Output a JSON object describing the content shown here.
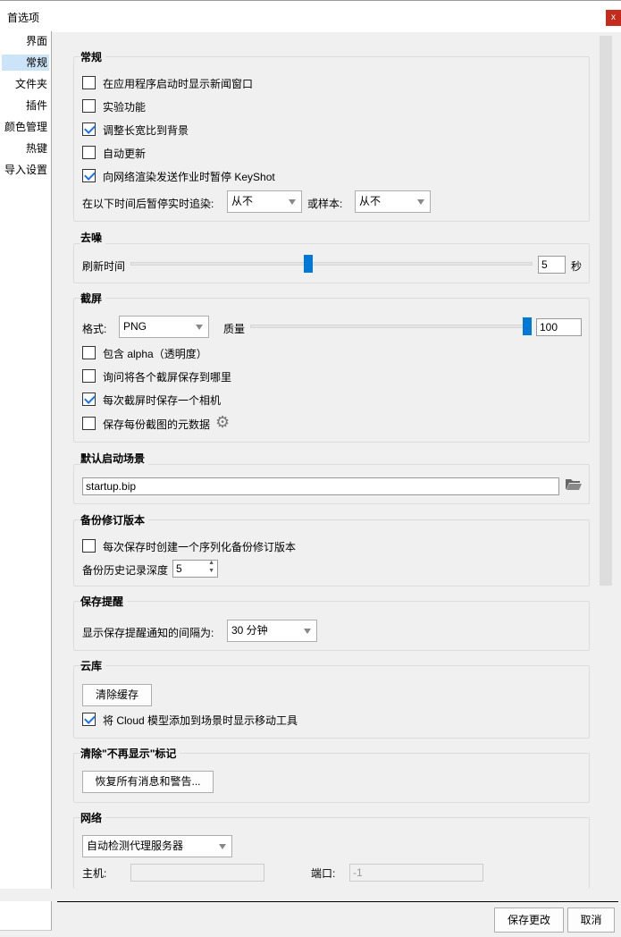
{
  "window": {
    "title": "首选项",
    "close": "x"
  },
  "sidebar": {
    "items": [
      {
        "label": "界面"
      },
      {
        "label": "常规",
        "selected": true
      },
      {
        "label": "文件夹"
      },
      {
        "label": "插件"
      },
      {
        "label": "颜色管理"
      },
      {
        "label": "热键"
      },
      {
        "label": "导入设置"
      }
    ]
  },
  "general": {
    "title": "常规",
    "options": [
      {
        "label": "在应用程序启动时显示新闻窗口",
        "checked": false
      },
      {
        "label": "实验功能",
        "checked": false
      },
      {
        "label": "调整长宽比到背景",
        "checked": true
      },
      {
        "label": "自动更新",
        "checked": false
      },
      {
        "label": "向网络渲染发送作业时暂停 KeyShot",
        "checked": true
      }
    ],
    "pause_label": "在以下时间后暂停实时追染:",
    "pause_value": "从不",
    "samples_label": "或样本:",
    "samples_value": "从不"
  },
  "denoise": {
    "title": "去噪",
    "refresh_label": "刷新时间",
    "value": "5",
    "unit": "秒",
    "slider_fraction": 0.44
  },
  "screenshot": {
    "title": "截屏",
    "format_label": "格式:",
    "format_value": "PNG",
    "quality_label": "质量",
    "quality_value": "100",
    "quality_fraction": 1.0,
    "options": [
      {
        "label": "包含 alpha（透明度）",
        "checked": false
      },
      {
        "label": "询问将各个截屏保存到哪里",
        "checked": false
      },
      {
        "label": "每次截屏时保存一个相机",
        "checked": true
      },
      {
        "label": "保存每份截图的元数据",
        "checked": false
      }
    ]
  },
  "startup": {
    "title": "默认启动场景",
    "value": "startup.bip"
  },
  "backup": {
    "title": "备份修订版本",
    "option": "每次保存时创建一个序列化备份修订版本",
    "option_checked": false,
    "depth_label": "备份历史记录深度",
    "depth_value": "5"
  },
  "reminder": {
    "title": "保存提醒",
    "label": "显示保存提醒通知的间隔为:",
    "value": "30 分钟"
  },
  "cloud": {
    "title": "云库",
    "clear_cache": "清除缓存",
    "option": "将 Cloud 模型添加到场景时显示移动工具",
    "option_checked": true
  },
  "dontshow": {
    "title": "清除\"不再显示\"标记",
    "restore": "恢复所有消息和警告..."
  },
  "network": {
    "title": "网络",
    "proxy": "自动检测代理服务器",
    "host_label": "主机:",
    "host_value": "",
    "port_label": "端口:",
    "port_value": "-1"
  },
  "footer": {
    "save": "保存更改",
    "cancel": "取消"
  }
}
